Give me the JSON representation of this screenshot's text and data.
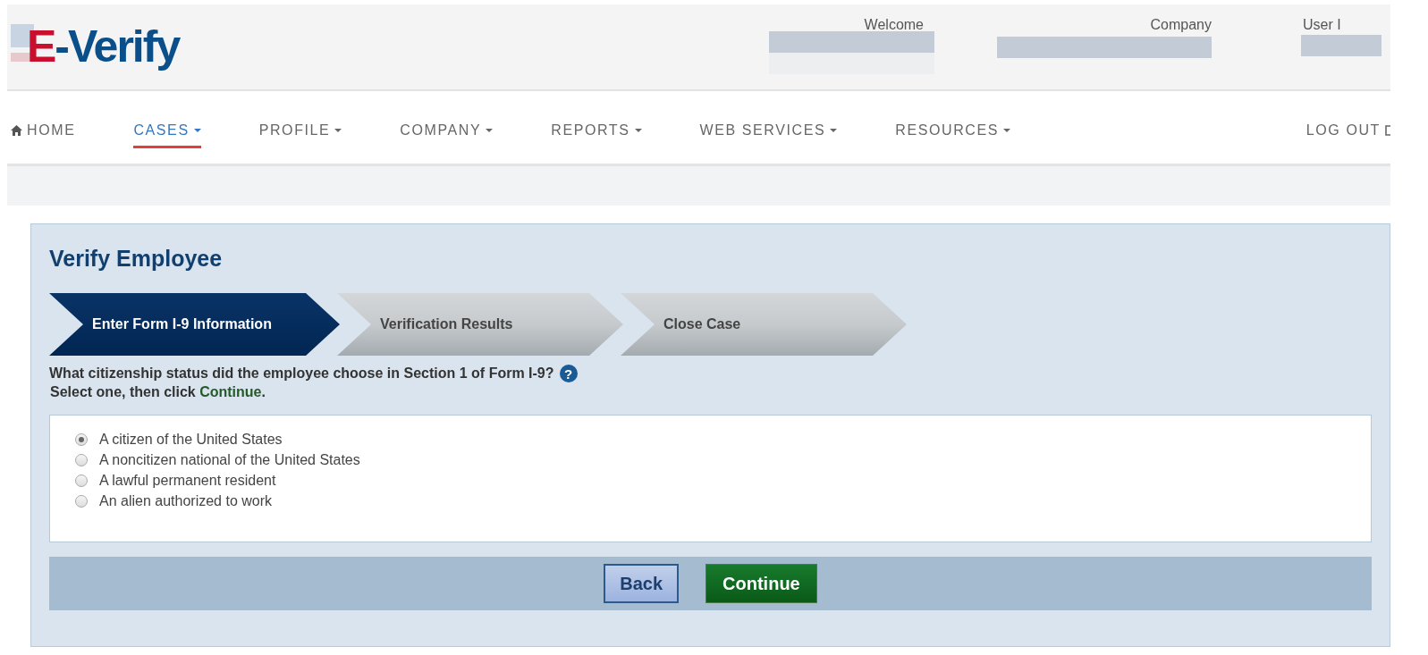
{
  "header": {
    "logo": {
      "first": "E",
      "rest": "-Verify"
    },
    "user_info": [
      {
        "label": "Welcome"
      },
      {
        "label": "Company"
      },
      {
        "label": "User I"
      }
    ]
  },
  "nav": {
    "items": [
      {
        "label": "HOME",
        "kind": "home",
        "caret": false,
        "selected": false
      },
      {
        "label": "CASES",
        "caret": true,
        "selected": true
      },
      {
        "label": "PROFILE",
        "caret": true,
        "selected": false
      },
      {
        "label": "COMPANY",
        "caret": true,
        "selected": false
      },
      {
        "label": "REPORTS",
        "caret": true,
        "selected": false
      },
      {
        "label": "WEB SERVICES",
        "caret": true,
        "selected": false
      },
      {
        "label": "RESOURCES",
        "caret": true,
        "selected": false
      }
    ],
    "logout": {
      "label": "LOG OUT"
    }
  },
  "panel": {
    "title": "Verify Employee",
    "steps": [
      {
        "label": "Enter Form I-9 Information",
        "selected": true
      },
      {
        "label": "Verification Results",
        "selected": false
      },
      {
        "label": "Close Case",
        "selected": false
      }
    ],
    "question": "What citizenship status did the employee choose in Section 1 of Form I-9?",
    "help_icon": "?",
    "instruction": {
      "before": "Select one, then click ",
      "highlight": "Continue",
      "after": "."
    },
    "options": [
      {
        "label": "A citizen of the United States",
        "selected": true
      },
      {
        "label": "A noncitizen national of the United States",
        "selected": false
      },
      {
        "label": "A lawful permanent resident",
        "selected": false
      },
      {
        "label": "An alien authorized to work",
        "selected": false
      }
    ],
    "buttons": [
      {
        "label": "Back",
        "kind": "secondary"
      },
      {
        "label": "Continue",
        "kind": "primary"
      }
    ]
  }
}
